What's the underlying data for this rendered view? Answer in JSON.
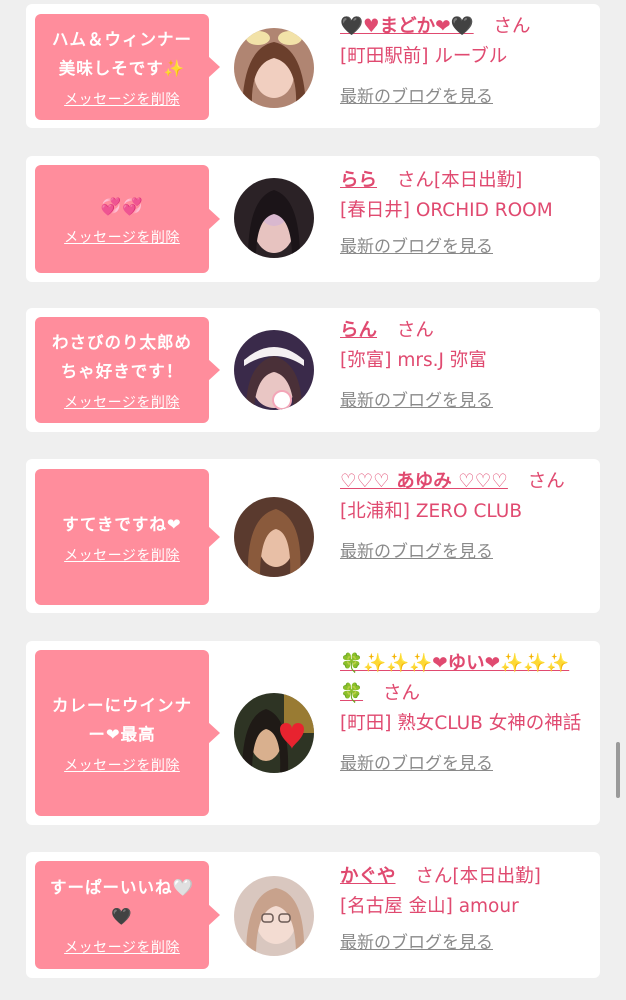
{
  "delete_label": "メッセージを削除",
  "san": "さん",
  "blog_link": "最新のブログを見る",
  "shukkin": "[本日出勤]",
  "entries": [
    {
      "message": "ハム＆ウィンナー\n美味しそです✨",
      "name": "🖤♥まどか❤🖤",
      "shop": "[町田駅前] ルーブル",
      "working_today": false
    },
    {
      "message": "💞💞",
      "name": "らら",
      "shop": "[春日井] ORCHID ROOM",
      "working_today": true
    },
    {
      "message": "わさびのり太郎め\nちゃ好きです！",
      "name": "らん",
      "shop": "[弥富] mrs.J 弥富",
      "working_today": false
    },
    {
      "message": "すてきですね❤",
      "name": "♡♡♡ あゆみ ♡♡♡",
      "shop": "[北浦和] ZERO CLUB",
      "working_today": false
    },
    {
      "message": "カレーにウインナ\nー❤最高",
      "name": "🍀✨✨✨❤ゆい❤✨✨✨🍀",
      "shop": "[町田] 熟女CLUB 女神の神話",
      "working_today": false
    },
    {
      "message": "すーぱーいいね🤍\n🖤",
      "name": "かぐや",
      "shop": "[名古屋 金山] amour",
      "working_today": true
    }
  ]
}
